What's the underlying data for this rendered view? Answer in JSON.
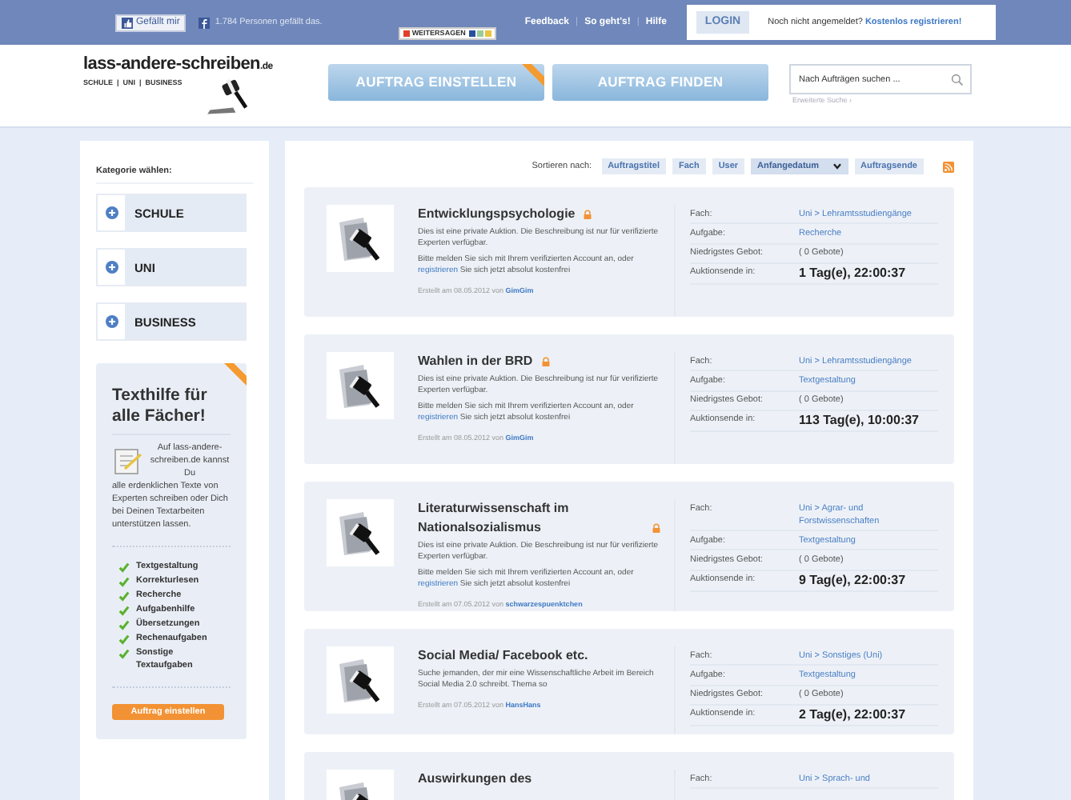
{
  "topbar": {
    "like_button": "Gefällt mir",
    "like_count": "1.784 Personen gefällt das.",
    "share": "WEITERSAGEN",
    "links": [
      "Feedback",
      "So geht's!",
      "Hilfe"
    ],
    "separator": "|",
    "login": "LOGIN",
    "not_logged_in": "Noch nicht angemeldet?",
    "register": "Kostenlos registrieren!"
  },
  "header": {
    "logo": "lass-andere-schreiben",
    "logo_tld": ".de",
    "tagline": "SCHULE  |  UNI  |  BUSINESS",
    "buttons": [
      "AUFTRAG EINSTELLEN",
      "AUFTRAG FINDEN"
    ],
    "search": {
      "placeholder": "Nach Aufträgen suchen ..."
    },
    "advanced_search": "Erweiterte Suche ›"
  },
  "sidebar": {
    "heading": "Kategorie wählen:",
    "categories": [
      "SCHULE",
      "UNI",
      "BUSINESS"
    ],
    "promo": {
      "title": "Texthilfe für alle Fächer!",
      "text_beside": "Auf lass-andere-schreiben.de kannst Du",
      "text_below": "alle erdenklichen Texte von Experten schreiben oder Dich bei Deinen Textarbeiten unterstützen lassen.",
      "features": [
        "Textgestaltung",
        "Korrekturlesen",
        "Recherche",
        "Aufgabenhilfe",
        "Übersetzungen",
        "Rechenaufgaben",
        "Sonstige Textaufgaben"
      ],
      "button": "Auftrag einstellen"
    }
  },
  "sort": {
    "label": "Sortieren nach:",
    "options": [
      {
        "label": "Auftragstitel",
        "selected": false
      },
      {
        "label": "Fach",
        "selected": false
      },
      {
        "label": "User",
        "selected": false
      },
      {
        "label": "Anfangedatum",
        "selected": true
      },
      {
        "label": "Auftragsende",
        "selected": false
      }
    ]
  },
  "listings": [
    {
      "title": "Entwicklungspsychologie",
      "locked": true,
      "kind": "private",
      "notice": "Dies ist eine private Auktion. Die Beschreibung ist nur für verifizierte Experten verfügbar.",
      "login_before": "Bitte melden Sie sich mit Ihrem verifizierten Account an, oder",
      "login_link": "registrieren",
      "login_after": "Sie sich jetzt absolut kostenfrei",
      "created": "Erstellt am 08.05.2012 von",
      "user": "GimGim",
      "fach_label": "Fach:",
      "fach": "Uni > Lehramtsstudiengänge",
      "aufgabe_label": "Aufgabe:",
      "aufgabe": "Recherche",
      "gebot_label": "Niedrigstes Gebot:",
      "gebot": "( 0 Gebote)",
      "ende_label": "Auktionsende in:",
      "ende": "1 Tag(e), 22:00:37"
    },
    {
      "title": "Wahlen in der BRD",
      "locked": true,
      "kind": "private",
      "notice": "Dies ist eine private Auktion. Die Beschreibung ist nur für verifizierte Experten verfügbar.",
      "login_before": "Bitte melden Sie sich mit Ihrem verifizierten Account an, oder",
      "login_link": "registrieren",
      "login_after": "Sie sich jetzt absolut kostenfrei",
      "created": "Erstellt am 08.05.2012 von",
      "user": "GimGim",
      "fach_label": "Fach:",
      "fach": "Uni > Lehramtsstudiengänge",
      "aufgabe_label": "Aufgabe:",
      "aufgabe": "Textgestaltung",
      "gebot_label": "Niedrigstes Gebot:",
      "gebot": "( 0 Gebote)",
      "ende_label": "Auktionsende in:",
      "ende": "113 Tag(e), 10:00:37"
    },
    {
      "title": "Literaturwissenschaft im Nationalsozialismus",
      "locked": true,
      "kind": "private",
      "notice": "Dies ist eine private Auktion. Die Beschreibung ist nur für verifizierte Experten verfügbar.",
      "login_before": "Bitte melden Sie sich mit Ihrem verifizierten Account an, oder",
      "login_link": "registrieren",
      "login_after": "Sie sich jetzt absolut kostenfrei",
      "created": "Erstellt am 07.05.2012 von",
      "user": "schwarzespuenktchen",
      "fach_label": "Fach:",
      "fach": "Uni > Agrar- und Forstwissenschaften",
      "aufgabe_label": "Aufgabe:",
      "aufgabe": "Textgestaltung",
      "gebot_label": "Niedrigstes Gebot:",
      "gebot": "( 0 Gebote)",
      "ende_label": "Auktionsende in:",
      "ende": "9 Tag(e), 22:00:37"
    },
    {
      "title": "Social Media/ Facebook etc.",
      "locked": false,
      "kind": "public",
      "description": "Suche jemanden, der mir eine Wissenschaftliche Arbeit im Bereich Social Media 2.0 schreibt. Thema so",
      "created": "Erstellt am 07.05.2012 von",
      "user": "HansHans",
      "fach_label": "Fach:",
      "fach": "Uni > Sonstiges (Uni)",
      "aufgabe_label": "Aufgabe:",
      "aufgabe": "Textgestaltung",
      "gebot_label": "Niedrigstes Gebot:",
      "gebot": "( 0 Gebote)",
      "ende_label": "Auktionsende in:",
      "ende": "2 Tag(e), 22:00:37"
    },
    {
      "title": "Auswirkungen des",
      "locked": false,
      "kind": "cut",
      "fach_label": "Fach:",
      "fach": "Uni > Sprach- und"
    }
  ]
}
